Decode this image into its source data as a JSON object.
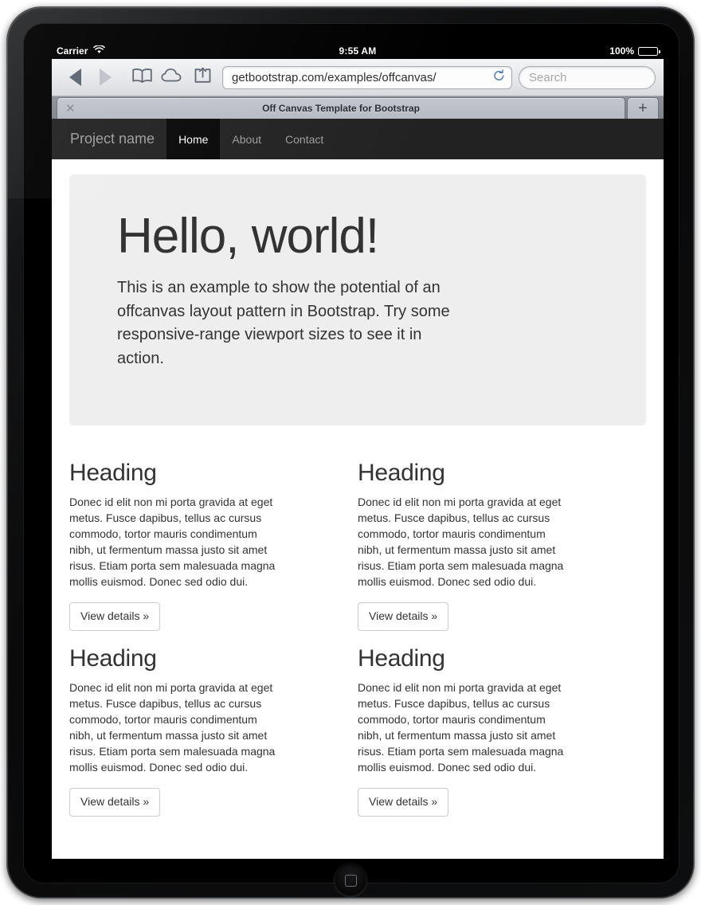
{
  "device": {
    "name": "ipad-tablet-frame",
    "home_button_icon": "rounded-square-icon"
  },
  "status_bar": {
    "carrier": "Carrier",
    "wifi_icon": "wifi-icon",
    "time": "9:55 AM",
    "battery_percent": "100%",
    "battery_icon": "battery-full-icon"
  },
  "browser": {
    "toolbar": {
      "back_icon": "back-arrow-icon",
      "forward_icon": "forward-arrow-icon",
      "bookmarks_icon": "book-icon",
      "icloud_tabs_icon": "cloud-icon",
      "share_icon": "share-icon",
      "reload_icon": "reload-icon"
    },
    "url_bar": {
      "value": "getbootstrap.com/examples/offcanvas/",
      "placeholder": "Enter website name"
    },
    "search_bar": {
      "value": "",
      "placeholder": "Search"
    },
    "tabs": {
      "close_icon": "close-icon",
      "new_tab_icon": "plus-icon",
      "active_tab_title": "Off Canvas Template for Bootstrap"
    }
  },
  "page": {
    "navbar": {
      "brand": "Project name",
      "items": [
        {
          "label": "Home",
          "active": true
        },
        {
          "label": "About",
          "active": false
        },
        {
          "label": "Contact",
          "active": false
        }
      ]
    },
    "jumbotron": {
      "title": "Hello, world!",
      "text": "This is an example to show the potential of an offcanvas layout pattern in Bootstrap. Try some responsive-range viewport sizes to see it in action."
    },
    "features": [
      {
        "heading": "Heading",
        "text": "Donec id elit non mi porta gravida at eget metus. Fusce dapibus, tellus ac cursus commodo, tortor mauris condimentum nibh, ut fermentum massa justo sit amet risus. Etiam porta sem malesuada magna mollis euismod. Donec sed odio dui.",
        "button": "View details »"
      },
      {
        "heading": "Heading",
        "text": "Donec id elit non mi porta gravida at eget metus. Fusce dapibus, tellus ac cursus commodo, tortor mauris condimentum nibh, ut fermentum massa justo sit amet risus. Etiam porta sem malesuada magna mollis euismod. Donec sed odio dui.",
        "button": "View details »"
      },
      {
        "heading": "Heading",
        "text": "Donec id elit non mi porta gravida at eget metus. Fusce dapibus, tellus ac cursus commodo, tortor mauris condimentum nibh, ut fermentum massa justo sit amet risus. Etiam porta sem malesuada magna mollis euismod. Donec sed odio dui.",
        "button": "View details »"
      },
      {
        "heading": "Heading",
        "text": "Donec id elit non mi porta gravida at eget metus. Fusce dapibus, tellus ac cursus commodo, tortor mauris condimentum nibh, ut fermentum massa justo sit amet risus. Etiam porta sem malesuada magna mollis euismod. Donec sed odio dui.",
        "button": "View details »"
      }
    ]
  },
  "colors": {
    "navbar_bg": "#222222",
    "navbar_active_bg": "#080808",
    "navbar_link": "#9d9d9d",
    "jumbotron_bg": "#eeeeee",
    "text": "#333333",
    "button_border": "#cccccc",
    "status_bar_bg": "#000000"
  }
}
